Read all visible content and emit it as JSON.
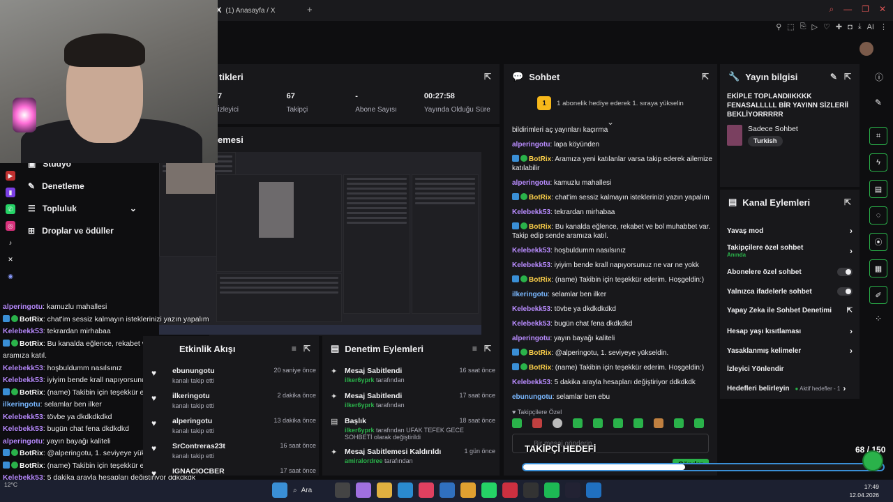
{
  "browser": {
    "tab_title": "(1) Anasayfa / X",
    "tab_logo": "X",
    "new_tab": "+",
    "ext_ai": "AI"
  },
  "stats": {
    "header": "tikleri",
    "items": [
      {
        "value": "7",
        "label": "İzleyici"
      },
      {
        "value": "67",
        "label": "Takipçi"
      },
      {
        "value": "-",
        "label": "Abone Sayısı"
      },
      {
        "value": "00:27:58",
        "label": "Yayında Olduğu Süre"
      }
    ]
  },
  "preview": {
    "header": "emesi"
  },
  "sidebar": {
    "items": [
      {
        "label": "Stüdyo"
      },
      {
        "label": "Denetleme"
      },
      {
        "label": "Topluluk"
      },
      {
        "label": "Droplar ve ödüller"
      }
    ]
  },
  "overlay_chat": [
    {
      "user": "alperingotu",
      "text": ": kamuzlu mahallesi",
      "color": "#b98cff",
      "bot": false
    },
    {
      "user": "BotRix",
      "text": ": chat'im sessiz kalmayın isteklerinizi yazın yapalım",
      "color": "#ffffff",
      "bot": true
    },
    {
      "user": "Kelebekk53",
      "text": ": tekrardan mirhabaa",
      "color": "#b98cff",
      "bot": false
    },
    {
      "user": "BotRix",
      "text": ": Bu kanalda eğlence, rekabet ve bol muhabbet var. Takip edip sende",
      "color": "#ffffff",
      "bot": true
    },
    {
      "user": "",
      "text": "aramıza katıl.",
      "color": "#ffffff",
      "bot": false
    },
    {
      "user": "Kelebekk53",
      "text": ": hoşbuldumm nasılsınız",
      "color": "#b98cff",
      "bot": false
    },
    {
      "user": "Kelebekk53",
      "text": ": iyiyim bende krall napıyorsunuz ne var ne yokk",
      "color": "#b98cff",
      "bot": false
    },
    {
      "user": "BotRix",
      "text": ": (name) Takibin için teşekkür ederim. Hoşgeldin:)",
      "color": "#ffffff",
      "bot": true
    },
    {
      "user": "ilkeringotu",
      "text": ": selamlar ben ilker",
      "color": "#7ab8ff",
      "bot": false
    },
    {
      "user": "Kelebekk53",
      "text": ": tövbe ya dkdkdkdkd",
      "color": "#b98cff",
      "bot": false
    },
    {
      "user": "Kelebekk53",
      "text": ": bugün chat fena dkdkdkd",
      "color": "#b98cff",
      "bot": false
    },
    {
      "user": "alperingotu",
      "text": ": yayın bayağı kaliteli",
      "color": "#b98cff",
      "bot": false
    },
    {
      "user": "BotRix",
      "text": ": @alperingotu, 1. seviyeye yükseldin.",
      "color": "#ffffff",
      "bot": true
    },
    {
      "user": "BotRix",
      "text": ": (name) Takibin için teşekkür ederim. Hoşgeldin:)",
      "color": "#ffffff",
      "bot": true
    },
    {
      "user": "Kelebekk53",
      "text": ": 5 dakika arayla hesapları değiştiriyor ddkdkdk",
      "color": "#b98cff",
      "bot": false
    },
    {
      "user": "ebunungotu",
      "text": ": selamlar ben ebu",
      "color": "#7ab8ff",
      "bot": false
    }
  ],
  "activity": {
    "header": "Etkinlik Akışı",
    "rows": [
      {
        "name": "ebunungotu",
        "sub": "kanalı takip etti",
        "time": "20 saniye önce"
      },
      {
        "name": "ilkeringotu",
        "sub": "kanalı takip etti",
        "time": "2 dakika önce"
      },
      {
        "name": "alperingotu",
        "sub": "kanalı takip etti",
        "time": "13 dakika önce"
      },
      {
        "name": "SrContreras23t",
        "sub": "kanalı takip etti",
        "time": "16 saat önce"
      },
      {
        "name": "IGNACIOCBER",
        "sub": "",
        "time": "17 saat önce"
      }
    ]
  },
  "moderation": {
    "header": "Denetim Eylemleri",
    "rows": [
      {
        "title": "Mesaj Sabitlendi",
        "user": "ilker6yprk",
        "by": "tarafından",
        "time": "16 saat önce"
      },
      {
        "title": "Mesaj Sabitlendi",
        "user": "ilker6yprk",
        "by": "tarafından",
        "time": "17 saat önce"
      },
      {
        "title": "Başlık",
        "user": "ilker6yprk",
        "by": "tarafından UFAK TEFEK GECE SOHBETİ olarak değiştirildi",
        "time": "18 saat önce"
      },
      {
        "title": "Mesaj Sabitlemesi Kaldırıldı",
        "user": "amiralordree",
        "by": "tarafından",
        "time": "1 gün önce"
      }
    ]
  },
  "chat": {
    "header": "Sohbet",
    "gift_badge": "1",
    "gift_text": "1 abonelik hediye ederek 1. sıraya yükselin",
    "messages": [
      {
        "user": "",
        "text": "bildirimleri aç yayınları kaçırma",
        "color": "#efeff1",
        "bot": false
      },
      {
        "user": "alperingotu",
        "text": ": lapa köyünden",
        "color": "#b98cff",
        "bot": false
      },
      {
        "user": "BotRix",
        "text": ": Aramıza yeni katılanlar varsa takip ederek ailemize katılabilir",
        "color": "#ffd24a",
        "bot": true
      },
      {
        "user": "alperingotu",
        "text": ": kamuzlu mahallesi",
        "color": "#b98cff",
        "bot": false
      },
      {
        "user": "BotRix",
        "text": ": chat'im sessiz kalmayın isteklerinizi yazın yapalım",
        "color": "#ffd24a",
        "bot": true
      },
      {
        "user": "Kelebekk53",
        "text": ": tekrardan mirhabaa",
        "color": "#b98cff",
        "bot": false
      },
      {
        "user": "BotRix",
        "text": ": Bu kanalda eğlence, rekabet ve bol muhabbet var. Takip edip sende aramıza katıl.",
        "color": "#ffd24a",
        "bot": true
      },
      {
        "user": "Kelebekk53",
        "text": ": hoşbuldumm nasılsınız",
        "color": "#b98cff",
        "bot": false
      },
      {
        "user": "Kelebekk53",
        "text": ": iyiyim bende krall napıyorsunuz ne var ne yokk",
        "color": "#b98cff",
        "bot": false
      },
      {
        "user": "BotRix",
        "text": ": (name) Takibin için teşekkür ederim. Hoşgeldin:)",
        "color": "#ffd24a",
        "bot": true
      },
      {
        "user": "ilkeringotu",
        "text": ": selamlar ben ilker",
        "color": "#7ab8ff",
        "bot": false
      },
      {
        "user": "Kelebekk53",
        "text": ": tövbe ya dkdkdkdkd",
        "color": "#b98cff",
        "bot": false
      },
      {
        "user": "Kelebekk53",
        "text": ": bugün chat fena dkdkdkd",
        "color": "#b98cff",
        "bot": false
      },
      {
        "user": "alperingotu",
        "text": ": yayın bayağı kaliteli",
        "color": "#b98cff",
        "bot": false
      },
      {
        "user": "BotRix",
        "text": ": @alperingotu, 1. seviyeye yükseldin.",
        "color": "#ffd24a",
        "bot": true
      },
      {
        "user": "BotRix",
        "text": ": (name) Takibin için teşekkür ederim. Hoşgeldin:)",
        "color": "#ffd24a",
        "bot": true
      },
      {
        "user": "Kelebekk53",
        "text": ": 5 dakika arayla hesapları değiştiriyor ddkdkdk",
        "color": "#b98cff",
        "bot": false
      },
      {
        "user": "ebunungotu",
        "text": ": selamlar ben ebu",
        "color": "#7ab8ff",
        "bot": false
      }
    ],
    "subscriber_only_label": "Takipçilere Özel",
    "input_placeholder": "Bir mesaj gönderin",
    "send_label": "Gönder"
  },
  "stream_info": {
    "header": "Yayın bilgisi",
    "title": "EKİPLE TOPLANDIIKKKK FENASALLLLL BİR YAYINN SİZLERİİ BEKLİYORRRRR",
    "category": "Sadece Sohbet",
    "tag": "Turkish"
  },
  "channel_actions": {
    "header": "Kanal Eylemleri",
    "items": [
      {
        "label": "Yavaş mod",
        "sub": "",
        "control": "chevron"
      },
      {
        "label": "Takipçilere özel sohbet",
        "sub": "Anında",
        "control": "chevron"
      },
      {
        "label": "Abonelere özel sohbet",
        "sub": "",
        "control": "toggle"
      },
      {
        "label": "Yalnızca ifadelerle sohbet",
        "sub": "",
        "control": "toggle"
      },
      {
        "label": "Yapay Zeka ile Sohbet Denetimi",
        "sub": "",
        "control": "external"
      },
      {
        "label": "Hesap yaşı kısıtlaması",
        "sub": "",
        "control": "chevron"
      },
      {
        "label": "Yasaklanmış kelimeler",
        "sub": "",
        "control": "chevron"
      },
      {
        "label": "İzleyici Yönlendir",
        "sub": "",
        "control": "none"
      },
      {
        "label": "Hedefleri belirleyin",
        "sub": "Aktif hedefler - 1",
        "control": "chevron"
      }
    ]
  },
  "goal": {
    "label": "TAKİPÇİ HEDEFİ",
    "count": "68 / 150",
    "progress": 0.45
  },
  "taskbar": {
    "search_label": "Ara",
    "time": "17:49",
    "date": "12.04.2026",
    "weather": "12°C"
  },
  "colors": {
    "accent_green": "#2ab24a",
    "bot_badge_blue": "#3a8fd6",
    "panel_bg": "#18181b",
    "page_bg": "#0e0e10"
  }
}
